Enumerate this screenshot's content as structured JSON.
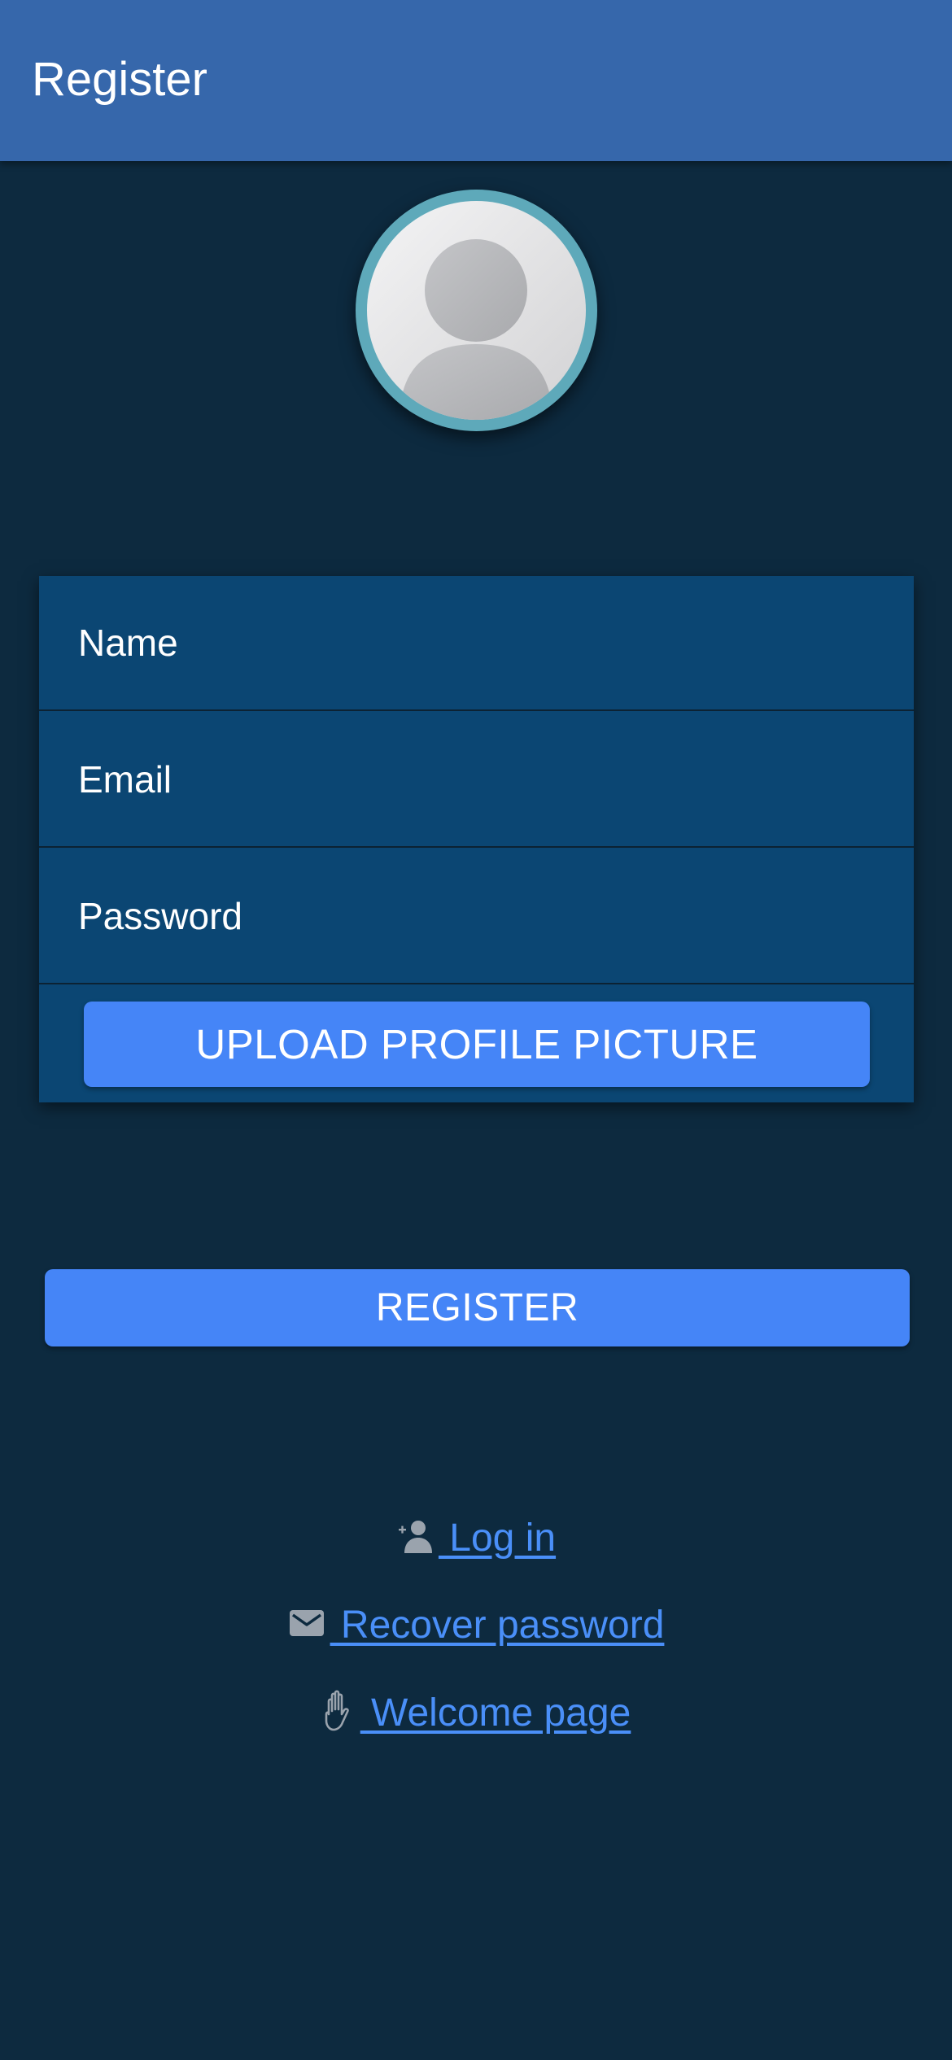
{
  "app_bar": {
    "title": "Register"
  },
  "avatar": {
    "icon": "default-avatar-icon"
  },
  "form": {
    "name_placeholder": "Name",
    "email_placeholder": "Email",
    "password_placeholder": "Password",
    "upload_label": "UPLOAD PROFILE PICTURE"
  },
  "register_label": "REGISTER",
  "links": {
    "login": {
      "icon": "add-user-icon",
      "label": " Log in"
    },
    "recover": {
      "icon": "mail-icon",
      "label": " Recover password"
    },
    "welcome": {
      "icon": "hand-icon",
      "label": " Welcome page"
    }
  },
  "colors": {
    "background": "#0d2a3f",
    "app_bar": "#3667ab",
    "card": "#0b4673",
    "primary_button": "#4585f7",
    "link": "#4a8ff8",
    "avatar_ring": "#5ea9ba"
  }
}
